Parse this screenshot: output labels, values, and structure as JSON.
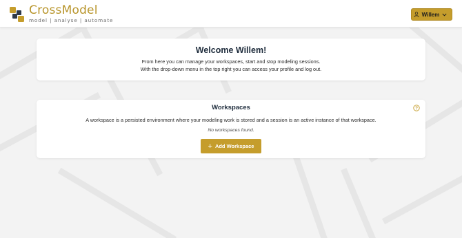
{
  "header": {
    "logo_name": "CrossModel",
    "logo_tagline": "model | analyse | automate",
    "user_button_label": "Willem"
  },
  "welcome": {
    "title": "Welcome Willem!",
    "line1": "From here you can manage your workspaces, start and stop modeling sessions.",
    "line2": "With the drop-down menu in the top right you can access your profile and log out."
  },
  "workspaces": {
    "title": "Workspaces",
    "description": "A workspace is a persisted environment where your modeling work is stored and a session is an active instance of that workspace.",
    "empty_message": "No workspaces found.",
    "add_button_label": "Add Workspace"
  },
  "colors": {
    "accent": "#c59d2c",
    "logo_gold": "#b8952b",
    "logo_dark": "#2e3a4a",
    "background": "#f3f3f3"
  },
  "icons": {
    "user": "user-icon",
    "chevron": "chevron-down-icon",
    "help": "help-circle-icon",
    "plus": "plus-icon"
  }
}
